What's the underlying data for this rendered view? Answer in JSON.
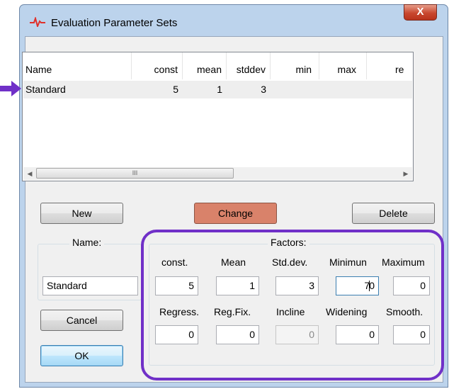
{
  "window": {
    "title": "Evaluation Parameter Sets",
    "close_label": "X",
    "icon": "pulse-icon",
    "accent": "#d9826a",
    "highlight_color": "#7030c8"
  },
  "list": {
    "columns": [
      "Name",
      "const",
      "mean",
      "stddev",
      "min",
      "max",
      "re"
    ],
    "rows": [
      {
        "name": "Standard",
        "const": "5",
        "mean": "1",
        "stddev": "3",
        "min": "",
        "max": ""
      }
    ],
    "scroll_thumb": "III"
  },
  "buttons": {
    "new": "New",
    "change": "Change",
    "delete": "Delete",
    "cancel": "Cancel",
    "ok": "OK"
  },
  "name_group": {
    "label": "Name:",
    "value": "Standard"
  },
  "factors": {
    "label": "Factors:",
    "row1": [
      {
        "label": "const.",
        "value": "5"
      },
      {
        "label": "Mean",
        "value": "1"
      },
      {
        "label": "Std.dev.",
        "value": "3"
      },
      {
        "label": "Minimun",
        "value_before_caret": "7",
        "value_after_caret": "0"
      },
      {
        "label": "Maximum",
        "value": "0"
      }
    ],
    "row2": [
      {
        "label": "Regress.",
        "value": "0"
      },
      {
        "label": "Reg.Fix.",
        "value": "0"
      },
      {
        "label": "Incline",
        "value": "0"
      },
      {
        "label": "Widening",
        "value": "0"
      },
      {
        "label": "Smooth.",
        "value": "0"
      }
    ]
  }
}
